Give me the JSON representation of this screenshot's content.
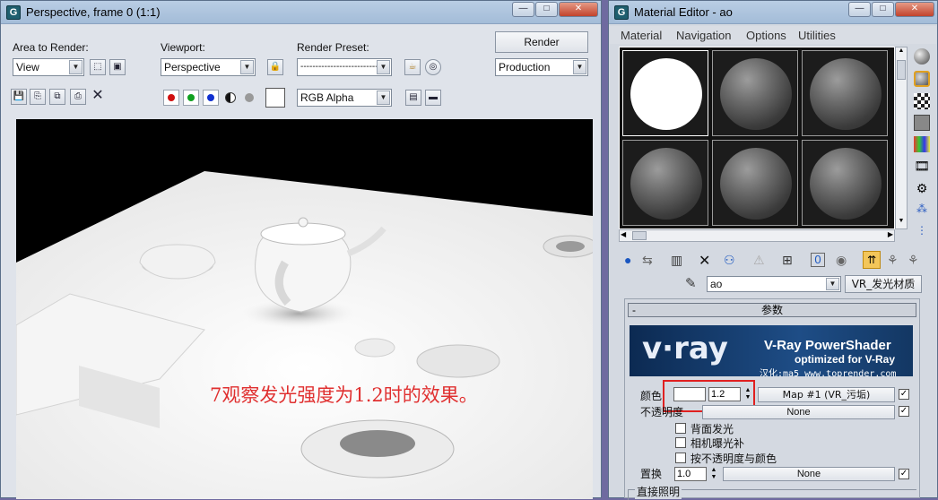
{
  "render_window": {
    "title": "Perspective, frame 0 (1:1)",
    "area_label": "Area to Render:",
    "area_value": "View",
    "viewport_label": "Viewport:",
    "viewport_value": "Perspective",
    "preset_label": "Render Preset:",
    "preset_value": "-----------------------------",
    "render_button": "Render",
    "production_value": "Production",
    "channel_value": "RGB Alpha",
    "annotation": "7观察发光强度为1.2时的效果。",
    "annotation_color": "#e03030"
  },
  "material_editor": {
    "title": "Material Editor - ao",
    "menu": [
      "Material",
      "Navigation",
      "Options",
      "Utilities"
    ],
    "material_name": "ao",
    "material_type": "VR_发光材质",
    "rollout_title": "参数",
    "vray_logo": "v·ray",
    "vray_title": "V-Ray PowerShader",
    "vray_subtitle": "optimized for V-Ray",
    "vray_credit": "汉化:ma5 www.toprender.com",
    "color_label": "颜色",
    "color_value": "1.2",
    "color_map": "Map #1 (VR_污垢)",
    "opacity_label": "不透明度",
    "opacity_map": "None",
    "options": [
      "背面发光",
      "相机曝光补",
      "按不透明度与颜色"
    ],
    "displace_label": "置换",
    "displace_value": "1.0",
    "displace_map": "None",
    "direct_label": "直接照明",
    "highlight_color": "#e02020"
  }
}
